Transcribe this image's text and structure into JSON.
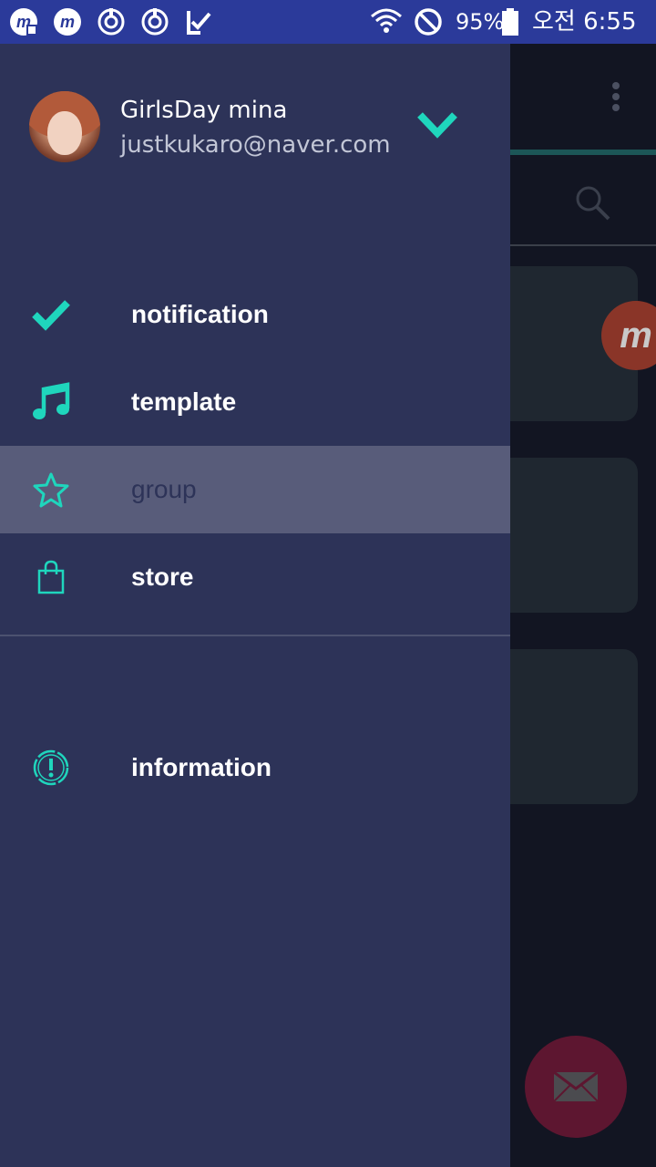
{
  "status_bar": {
    "battery": "95%",
    "time": "오전 6:55"
  },
  "drawer": {
    "user": {
      "name": "GirlsDay mina",
      "email": "justkukaro@naver.com"
    },
    "menu": [
      {
        "label": "notification",
        "icon": "check-icon"
      },
      {
        "label": "template",
        "icon": "music-note-icon"
      },
      {
        "label": "group",
        "icon": "star-icon",
        "selected": true
      },
      {
        "label": "store",
        "icon": "shopping-bag-icon"
      }
    ],
    "secondary_menu": [
      {
        "label": "information",
        "icon": "info-circle-icon"
      }
    ]
  },
  "background_app": {
    "badge_text": "m"
  },
  "colors": {
    "accent": "#1fd6bd",
    "drawer_bg": "#2d3358",
    "selected_bg": "#585c7a",
    "status_bar_bg": "#2b3a9a"
  }
}
